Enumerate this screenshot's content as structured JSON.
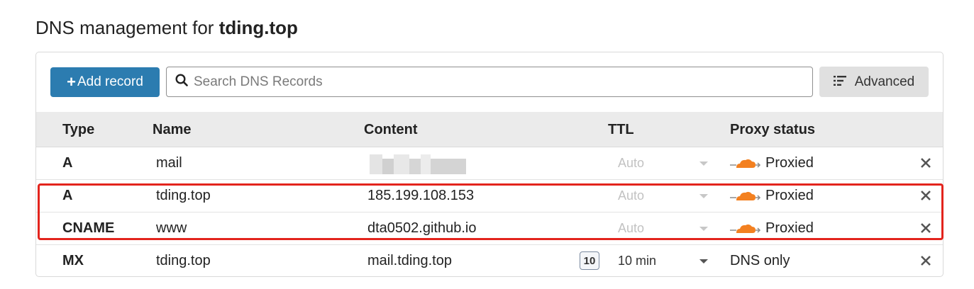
{
  "page": {
    "title_prefix": "DNS management for",
    "title_domain": "tding.top"
  },
  "toolbar": {
    "add_label": "Add record",
    "search_placeholder": "Search DNS Records",
    "advanced_label": "Advanced"
  },
  "table": {
    "headers": {
      "type": "Type",
      "name": "Name",
      "content": "Content",
      "ttl": "TTL",
      "proxy": "Proxy status"
    },
    "rows": [
      {
        "type": "A",
        "name": "mail",
        "content": "",
        "content_redacted": true,
        "ttl": "Auto",
        "ttl_badge": "",
        "proxy": "Proxied",
        "proxied": true
      },
      {
        "type": "A",
        "name": "tding.top",
        "content": "185.199.108.153",
        "content_redacted": false,
        "ttl": "Auto",
        "ttl_badge": "",
        "proxy": "Proxied",
        "proxied": true
      },
      {
        "type": "CNAME",
        "name": "www",
        "content": "dta0502.github.io",
        "content_redacted": false,
        "ttl": "Auto",
        "ttl_badge": "",
        "proxy": "Proxied",
        "proxied": true
      },
      {
        "type": "MX",
        "name": "tding.top",
        "content": "mail.tding.top",
        "content_redacted": false,
        "ttl": "10 min",
        "ttl_badge": "10",
        "proxy": "DNS only",
        "proxied": false
      }
    ]
  },
  "colors": {
    "primary_button": "#2c7cb0",
    "proxy_cloud": "#f38020",
    "highlight": "#e3241d"
  },
  "icons": {
    "search": "search-icon",
    "advanced": "list-icon",
    "proxy": "cloud-icon",
    "delete": "close-icon",
    "ttl_dropdown": "chevron-down-icon"
  }
}
